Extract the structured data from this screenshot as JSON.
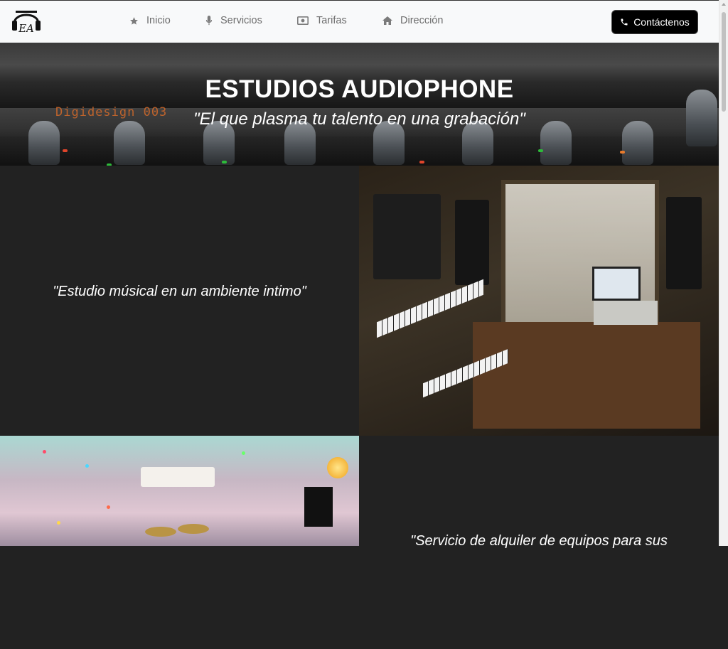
{
  "brand": {
    "logo_icon": "headphones-logo-icon",
    "logo_text": "EA"
  },
  "nav": [
    {
      "label": "Inicio",
      "icon": "star-icon"
    },
    {
      "label": "Servicios",
      "icon": "microphone-icon"
    },
    {
      "label": "Tarifas",
      "icon": "money-bill-icon"
    },
    {
      "label": "Dirección",
      "icon": "home-icon"
    }
  ],
  "contact_button": {
    "label": "Contáctenos",
    "icon": "phone-icon"
  },
  "hero": {
    "title": "ESTUDIOS AUDIOPHONE",
    "tagline": "\"El que plasma tu talento en una grabación\"",
    "display_text": "Digidesign 003"
  },
  "sections": [
    {
      "text": "\"Estudio músical en un ambiente intimo\"",
      "image": "recording-studio-photo"
    },
    {
      "text": "\"Servicio de alquiler de equipos para sus",
      "image": "rehearsal-room-photo"
    }
  ],
  "colors": {
    "nav_bg": "#f8f9fa",
    "dark_panel": "#222222",
    "button_bg": "#000000",
    "nav_text": "#6d6d6d"
  }
}
